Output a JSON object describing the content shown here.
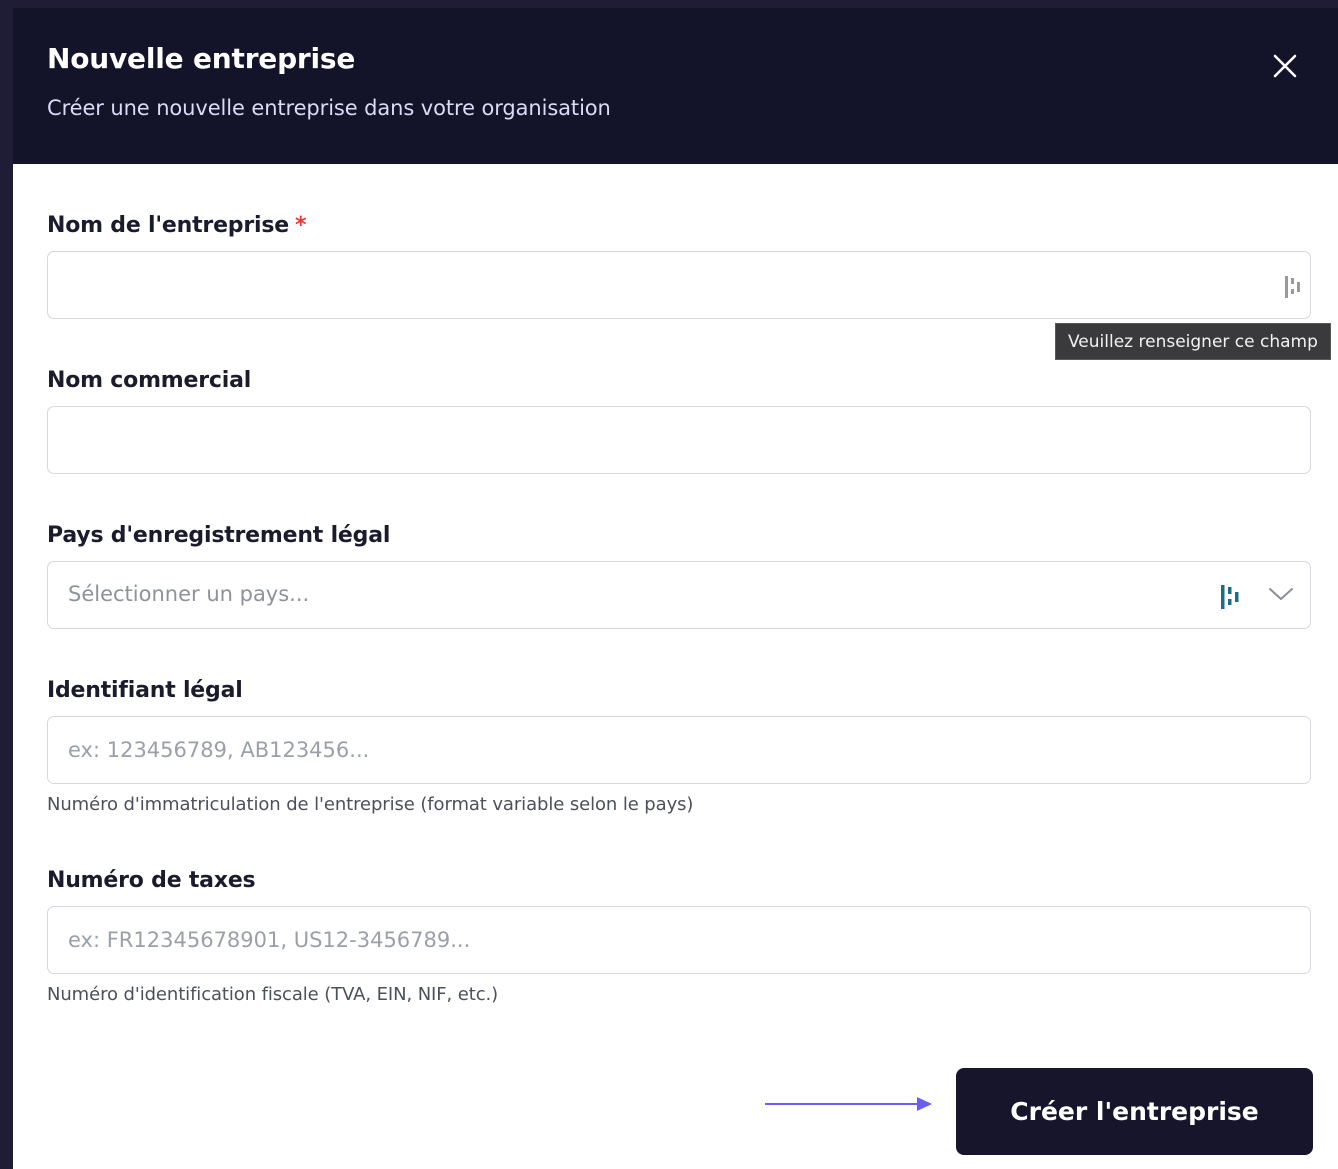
{
  "dialog": {
    "title": "Nouvelle entreprise",
    "subtitle": "Créer une nouvelle entreprise dans votre organisation",
    "close_icon": "close-icon"
  },
  "fields": {
    "company_name": {
      "label": "Nom de l'entreprise",
      "required_mark": "*",
      "value": "",
      "placeholder": ""
    },
    "trade_name": {
      "label": "Nom commercial",
      "value": "",
      "placeholder": ""
    },
    "country": {
      "label": "Pays d'enregistrement légal",
      "placeholder": "Sélectionner un pays..."
    },
    "legal_id": {
      "label": "Identifiant légal",
      "value": "",
      "placeholder": "ex: 123456789, AB123456...",
      "help": "Numéro d'immatriculation de l'entreprise (format variable selon le pays)"
    },
    "tax_number": {
      "label": "Numéro de taxes",
      "value": "",
      "placeholder": "ex: FR12345678901, US12-3456789...",
      "help": "Numéro d'identification fiscale (TVA, EIN, NIF, etc.)"
    }
  },
  "tooltip": {
    "text": "Veuillez renseigner ce champ"
  },
  "submit": {
    "label": "Créer l'entreprise"
  },
  "icons": {
    "password_manager": "password-manager-icon",
    "chevron": "chevron-down-icon",
    "arrow": "arrow-right-icon"
  },
  "colors": {
    "header_bg": "#13132a",
    "button_bg": "#16152c",
    "required": "#e53935",
    "arrow": "#6a5cf5",
    "pm_icon_active": "#1a6d85"
  }
}
